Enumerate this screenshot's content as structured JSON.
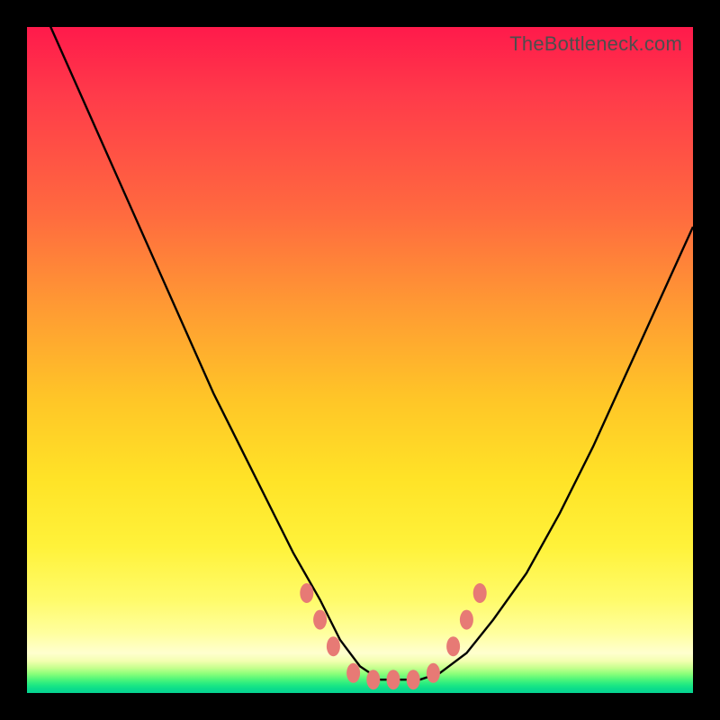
{
  "watermark": "TheBottleneck.com",
  "colors": {
    "frame": "#000000",
    "curve": "#000000",
    "marker_fill": "#e77a75",
    "marker_stroke": "#e77a75"
  },
  "chart_data": {
    "type": "line",
    "title": "",
    "xlabel": "",
    "ylabel": "",
    "xlim": [
      0,
      100
    ],
    "ylim": [
      0,
      100
    ],
    "grid": false,
    "legend": false,
    "note": "No axis ticks or numeric labels are rendered; values are estimated from pixel positions on a 0–100 normalized scale (origin bottom-left).",
    "series": [
      {
        "name": "bottleneck-curve",
        "x": [
          0,
          4,
          8,
          12,
          16,
          20,
          24,
          28,
          32,
          36,
          40,
          44,
          47,
          50,
          53,
          56,
          59,
          62,
          66,
          70,
          75,
          80,
          85,
          90,
          95,
          100
        ],
        "y": [
          108,
          99,
          90,
          81,
          72,
          63,
          54,
          45,
          37,
          29,
          21,
          14,
          8,
          4,
          2,
          2,
          2,
          3,
          6,
          11,
          18,
          27,
          37,
          48,
          59,
          70
        ]
      }
    ],
    "markers": [
      {
        "x": 42,
        "y": 15
      },
      {
        "x": 44,
        "y": 11
      },
      {
        "x": 46,
        "y": 7
      },
      {
        "x": 49,
        "y": 3
      },
      {
        "x": 52,
        "y": 2
      },
      {
        "x": 55,
        "y": 2
      },
      {
        "x": 58,
        "y": 2
      },
      {
        "x": 61,
        "y": 3
      },
      {
        "x": 64,
        "y": 7
      },
      {
        "x": 66,
        "y": 11
      },
      {
        "x": 68,
        "y": 15
      }
    ]
  }
}
